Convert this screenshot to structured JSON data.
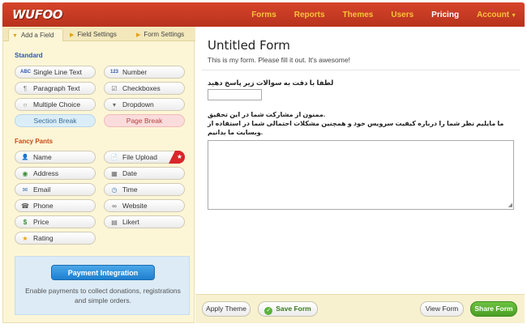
{
  "brand": {
    "logo": "WUFOO"
  },
  "nav": [
    {
      "label": "Forms",
      "active": false
    },
    {
      "label": "Reports",
      "active": false
    },
    {
      "label": "Themes",
      "active": false
    },
    {
      "label": "Users",
      "active": false
    },
    {
      "label": "Pricing",
      "active": true
    },
    {
      "label": "Account",
      "active": false,
      "caret": "▼"
    }
  ],
  "tabs": [
    {
      "label": "Add a Field"
    },
    {
      "label": "Field Settings"
    },
    {
      "label": "Form Settings"
    }
  ],
  "standard": {
    "title": "Standard",
    "fields": [
      {
        "label": "Single Line Text",
        "icon": "abc-icon",
        "glyph": "ABC"
      },
      {
        "label": "Number",
        "icon": "number-icon",
        "glyph": "123"
      },
      {
        "label": "Paragraph Text",
        "icon": "paragraph-icon",
        "glyph": "¶"
      },
      {
        "label": "Checkboxes",
        "icon": "checkbox-icon",
        "glyph": "☑"
      },
      {
        "label": "Multiple Choice",
        "icon": "radio-icon",
        "glyph": "○"
      },
      {
        "label": "Dropdown",
        "icon": "dropdown-icon",
        "glyph": "▾"
      },
      {
        "label": "Section Break",
        "icon": "",
        "glyph": ""
      },
      {
        "label": "Page Break",
        "icon": "",
        "glyph": ""
      }
    ]
  },
  "fancy": {
    "title": "Fancy Pants",
    "fields": [
      {
        "label": "Name",
        "icon": "person-icon",
        "glyph": "👤"
      },
      {
        "label": "File Upload",
        "icon": "file-upload-icon",
        "glyph": "📄"
      },
      {
        "label": "Address",
        "icon": "globe-icon",
        "glyph": "◉"
      },
      {
        "label": "Date",
        "icon": "calendar-icon",
        "glyph": "▦"
      },
      {
        "label": "Email",
        "icon": "email-icon",
        "glyph": "✉"
      },
      {
        "label": "Time",
        "icon": "clock-icon",
        "glyph": "◷"
      },
      {
        "label": "Phone",
        "icon": "phone-icon",
        "glyph": "☎"
      },
      {
        "label": "Website",
        "icon": "link-icon",
        "glyph": "∞"
      },
      {
        "label": "Price",
        "icon": "price-icon",
        "glyph": "$"
      },
      {
        "label": "Likert",
        "icon": "likert-icon",
        "glyph": "▤"
      },
      {
        "label": "Rating",
        "icon": "star-icon",
        "glyph": "★"
      }
    ],
    "star_badge": "★"
  },
  "payment": {
    "button": "Payment Integration",
    "text": "Enable payments to collect donations, registrations and simple orders."
  },
  "form": {
    "title": "Untitled Form",
    "description": "This is my form. Please fill it out. It's awesome!",
    "q1_label": "لطفا با دقت به سوالات زیر پاسخ دهید",
    "q2_line1": "ممنون از مشارکت شما در این تحقیق.",
    "q2_line2": "ما مایلیم نظر شما را درباره کیفیت سرویس خود و همچنین مشکلات احتمالی شما در استفاده از",
    "q2_line3": "وبسایت ما بدانیم."
  },
  "bottom": {
    "apply_theme": "Apply Theme",
    "save_form": "Save Form",
    "view_form": "View Form",
    "share_form": "Share Form"
  },
  "colors": {
    "header": "#c83a22",
    "nav_link": "#f7c43a",
    "panel_bg": "#fdf6d6",
    "accent_blue": "#2f56a8",
    "fancy_orange": "#c84a16",
    "share_green": "#5bb33a"
  }
}
